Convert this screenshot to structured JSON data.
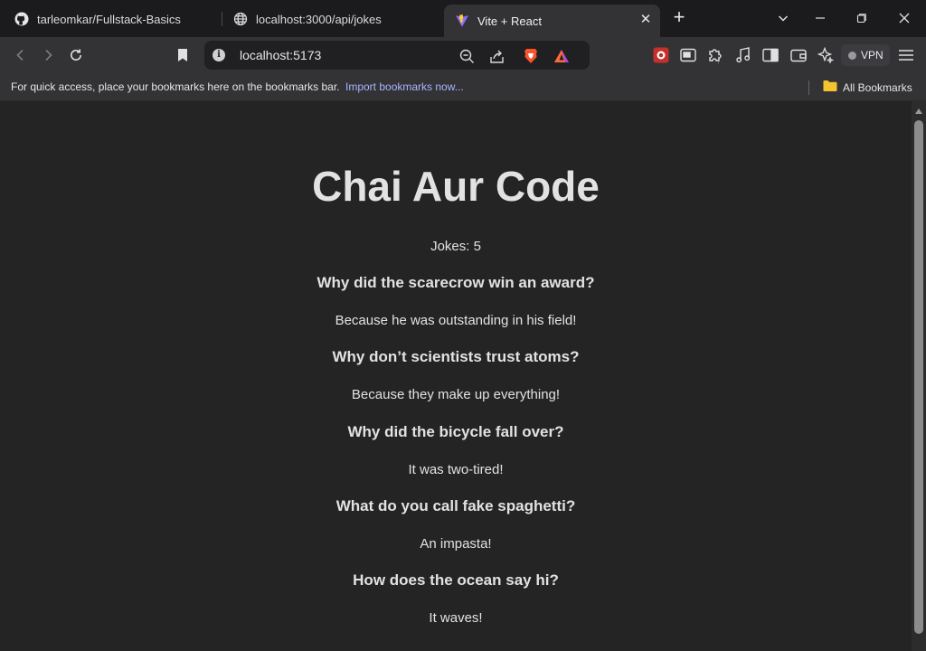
{
  "browser": {
    "tabs": [
      {
        "label": "tarleomkar/Fullstack-Basics",
        "icon": "github-icon"
      },
      {
        "label": "localhost:3000/api/jokes",
        "icon": "globe-icon"
      },
      {
        "label": "Vite + React",
        "icon": "vite-icon",
        "active": true
      }
    ],
    "address": "localhost:5173",
    "vpn_label": "VPN",
    "bookmarks_message": "For quick access, place your bookmarks here on the bookmarks bar.",
    "import_link": "Import bookmarks now...",
    "all_bookmarks": "All Bookmarks"
  },
  "page": {
    "title": "Chai Aur Code",
    "jokes_count_label": "Jokes: 5",
    "jokes": [
      {
        "question": "Why did the scarecrow win an award?",
        "answer": "Because he was outstanding in his field!"
      },
      {
        "question": "Why don’t scientists trust atoms?",
        "answer": "Because they make up everything!"
      },
      {
        "question": "Why did the bicycle fall over?",
        "answer": "It was two-tired!"
      },
      {
        "question": "What do you call fake spaghetti?",
        "answer": "An impasta!"
      },
      {
        "question": "How does the ocean say hi?",
        "answer": "It waves!"
      }
    ]
  },
  "colors": {
    "page_background": "#242424",
    "tabstrip_background": "#1b1b1e",
    "toolbar_background": "#333336",
    "link_color": "#a7b6ff",
    "brave_orange": "#fb542b"
  }
}
